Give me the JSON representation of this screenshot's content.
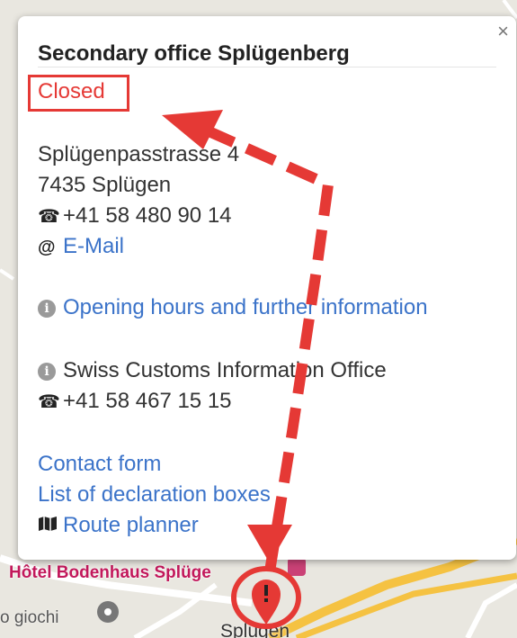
{
  "popup": {
    "title": "Secondary office Splügenberg",
    "close_glyph": "×",
    "status": "Closed",
    "address_line1": "Splügenpasstrasse 4",
    "address_line2": "7435 Splügen",
    "phone": "+41 58 480 90 14",
    "email_label": "E-Mail",
    "opening_hours_link": "Opening hours and further information",
    "info_office": "Swiss Customs Information Office",
    "info_phone": "+41 58 467 15 15",
    "contact_form_link": "Contact form",
    "declaration_boxes_link": "List of declaration boxes",
    "route_planner_link": "Route planner"
  },
  "map": {
    "hotel_label": "Hôtel Bodenhaus Splüge",
    "poi_label": "o giochi",
    "town_label": "Splügen"
  },
  "icons": {
    "phone": "phone-icon",
    "email": "at-icon",
    "info": "info-icon",
    "map": "map-icon",
    "marker": "warning-marker-icon"
  },
  "colors": {
    "status_red": "#e53935",
    "link_blue": "#3b73c9",
    "annotation_red": "#e53935",
    "road_yellow": "#f5c242"
  }
}
